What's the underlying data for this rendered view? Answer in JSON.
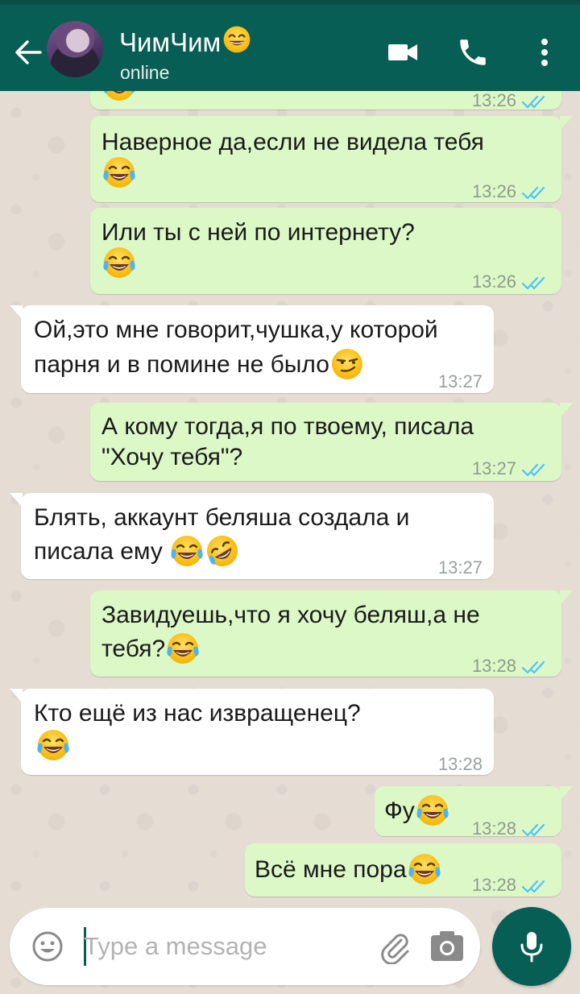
{
  "header": {
    "contact_name": "ЧимЧим",
    "status": "online",
    "back_icon": "arrow-left-icon",
    "video_icon": "video-camera-icon",
    "call_icon": "phone-icon",
    "menu_icon": "more-vertical-icon"
  },
  "messages": [
    {
      "direction": "out",
      "time": "13:26",
      "text_lines": []
    },
    {
      "direction": "out",
      "time": "13:26",
      "text_lines": [
        "Наверное да,если не видела тебя"
      ]
    },
    {
      "direction": "out",
      "time": "13:26",
      "text_lines": [
        "Или ты с ней по интернету?"
      ]
    },
    {
      "direction": "in",
      "time": "13:27",
      "text_lines": [
        "Ой,это мне говорит,чушка,у которой",
        "парня и в помине не было"
      ]
    },
    {
      "direction": "out",
      "time": "13:27",
      "text_lines": [
        "А кому тогда,я по твоему, писала",
        "\"Хочу тебя\"?"
      ]
    },
    {
      "direction": "in",
      "time": "13:27",
      "text_lines": [
        "Блять, аккаунт беляша создала и",
        "писала ему"
      ]
    },
    {
      "direction": "out",
      "time": "13:28",
      "text_lines": [
        "Завидуешь,что я хочу беляш,а не",
        "тебя?"
      ]
    },
    {
      "direction": "in",
      "time": "13:28",
      "text_lines": [
        "Кто ещё из нас извращенец?"
      ]
    },
    {
      "direction": "out",
      "time": "13:28",
      "text_lines": [
        "Фу"
      ]
    },
    {
      "direction": "out",
      "time": "13:28",
      "text_lines": [
        "Всё мне пора"
      ]
    }
  ],
  "composer": {
    "placeholder": "Type a message",
    "value": "",
    "emoji_icon": "smiley-icon",
    "attach_icon": "paperclip-icon",
    "camera_icon": "camera-icon",
    "mic_icon": "microphone-icon"
  },
  "colors": {
    "header": "#075E54",
    "outgoing_bubble": "#DCF8C6",
    "incoming_bubble": "#FFFFFF",
    "read_ticks": "#4FC3F7",
    "chat_background": "#E5DDD4"
  }
}
